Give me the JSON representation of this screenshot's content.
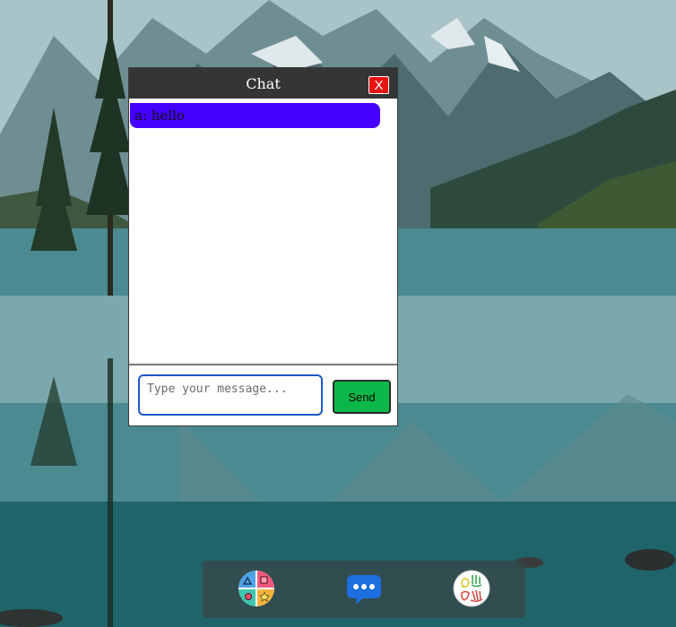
{
  "chat": {
    "title": "Chat",
    "close_label": "X",
    "messages": [
      {
        "text": "a: hello",
        "bg": "#4400ff"
      }
    ],
    "input": {
      "value": "",
      "placeholder": "Type your message..."
    },
    "send_label": "Send"
  },
  "dock": {
    "items": [
      {
        "icon": "shapes-grid-icon"
      },
      {
        "icon": "chat-bubble-icon"
      },
      {
        "icon": "hands-icon"
      }
    ]
  },
  "colors": {
    "titlebar": "#353535",
    "close_button": "#e81313",
    "message_bubble": "#4400ff",
    "send_button": "#0ab84a",
    "input_border": "#1e58c9",
    "chat_icon": "#1d6fe0"
  }
}
